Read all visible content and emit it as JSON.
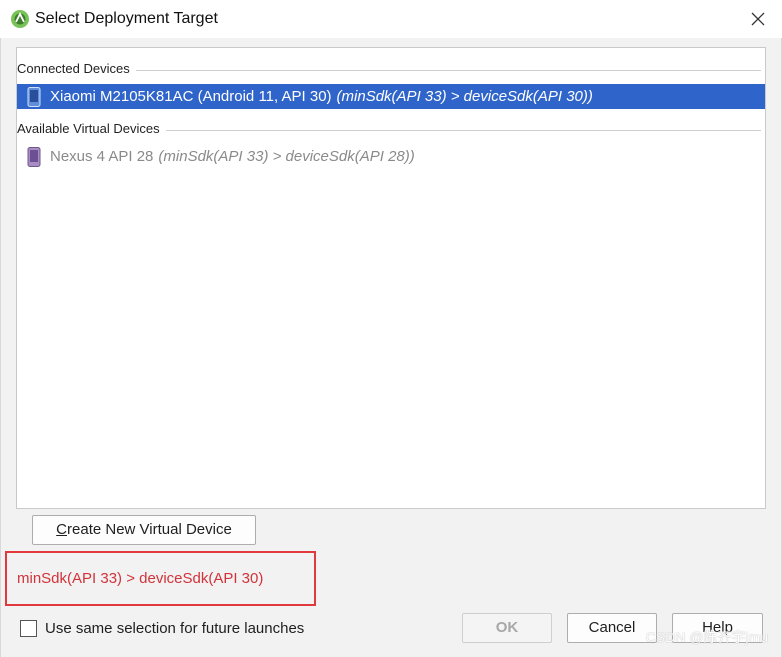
{
  "window": {
    "title": "Select Deployment Target"
  },
  "groups": [
    {
      "label": "Connected Devices",
      "devices": [
        {
          "name": "Xiaomi M2105K81AC (Android 11, API 30)",
          "warning": "(minSdk(API 33) > deviceSdk(API 30))",
          "selected": true
        }
      ]
    },
    {
      "label": "Available Virtual Devices",
      "devices": [
        {
          "name": "Nexus 4 API 28",
          "warning": "(minSdk(API 33) > deviceSdk(API 28))",
          "selected": false
        }
      ]
    }
  ],
  "buttons": {
    "create_mnemonic": "C",
    "create_rest": "reate New Virtual Device",
    "ok": "OK",
    "cancel": "Cancel",
    "help": "Help"
  },
  "error": {
    "message": "minSdk(API 33) > deviceSdk(API 30)"
  },
  "checkbox": {
    "label": "Use same selection for future launches",
    "checked": false
  },
  "watermark": "CSDN @陈齐宇jmu",
  "colors": {
    "selection": "#2f65ca",
    "error": "#d0333a",
    "android_green": "#78c257"
  }
}
